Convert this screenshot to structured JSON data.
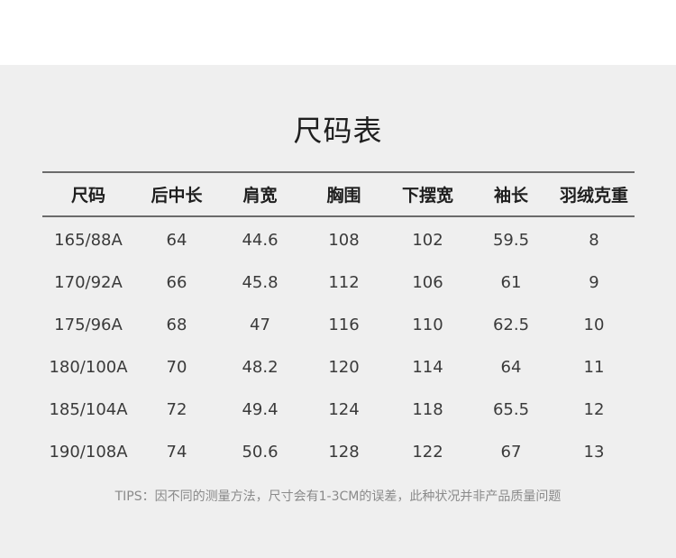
{
  "title": "尺码表",
  "table": {
    "headers": [
      "尺码",
      "后中长",
      "肩宽",
      "胸围",
      "下摆宽",
      "袖长",
      "羽绒克重"
    ],
    "rows": [
      [
        "165/88A",
        "64",
        "44.6",
        "108",
        "102",
        "59.5",
        "8"
      ],
      [
        "170/92A",
        "66",
        "45.8",
        "112",
        "106",
        "61",
        "9"
      ],
      [
        "175/96A",
        "68",
        "47",
        "116",
        "110",
        "62.5",
        "10"
      ],
      [
        "180/100A",
        "70",
        "48.2",
        "120",
        "114",
        "64",
        "11"
      ],
      [
        "185/104A",
        "72",
        "49.4",
        "124",
        "118",
        "65.5",
        "12"
      ],
      [
        "190/108A",
        "74",
        "50.6",
        "128",
        "122",
        "67",
        "13"
      ]
    ]
  },
  "tips": "TIPS：因不同的测量方法，尺寸会有1-3CM的误差，此种状况并非产品质量问题"
}
